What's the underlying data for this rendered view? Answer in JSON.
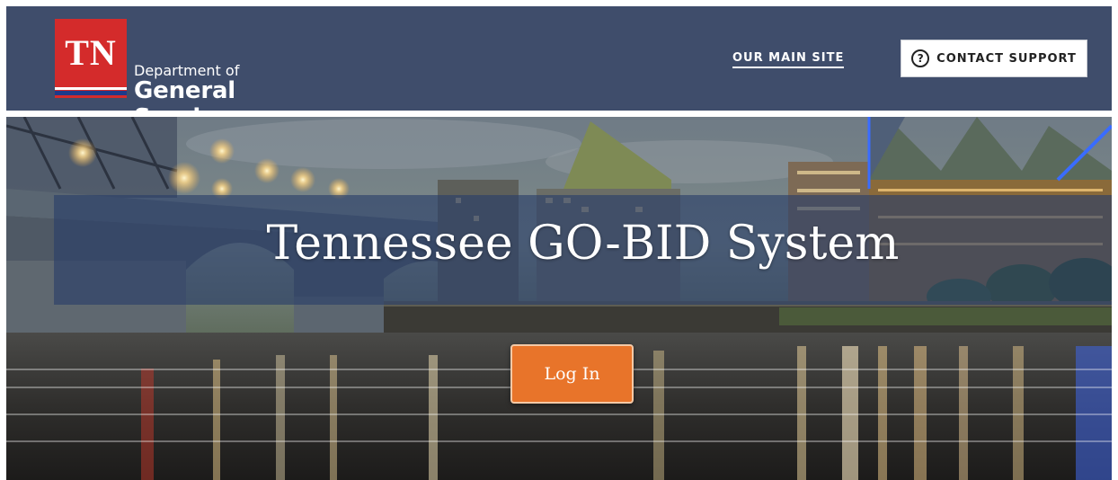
{
  "header": {
    "logo": {
      "badge_text": "TN",
      "dept_line1": "Department of",
      "dept_line2": "General Services"
    },
    "main_site_link": "OUR MAIN SITE",
    "contact_support": {
      "icon_glyph": "?",
      "label": "CONTACT SUPPORT"
    }
  },
  "hero": {
    "background": "night-city-river-bridge-photo",
    "title": "Tennessee GO-BID System",
    "login_button": "Log In"
  },
  "colors": {
    "header_bg": "#3f4d6b",
    "badge_red": "#d42b2b",
    "badge_blue": "#1f3a8a",
    "login_orange": "#e8742a",
    "title_band": "#283e69"
  }
}
